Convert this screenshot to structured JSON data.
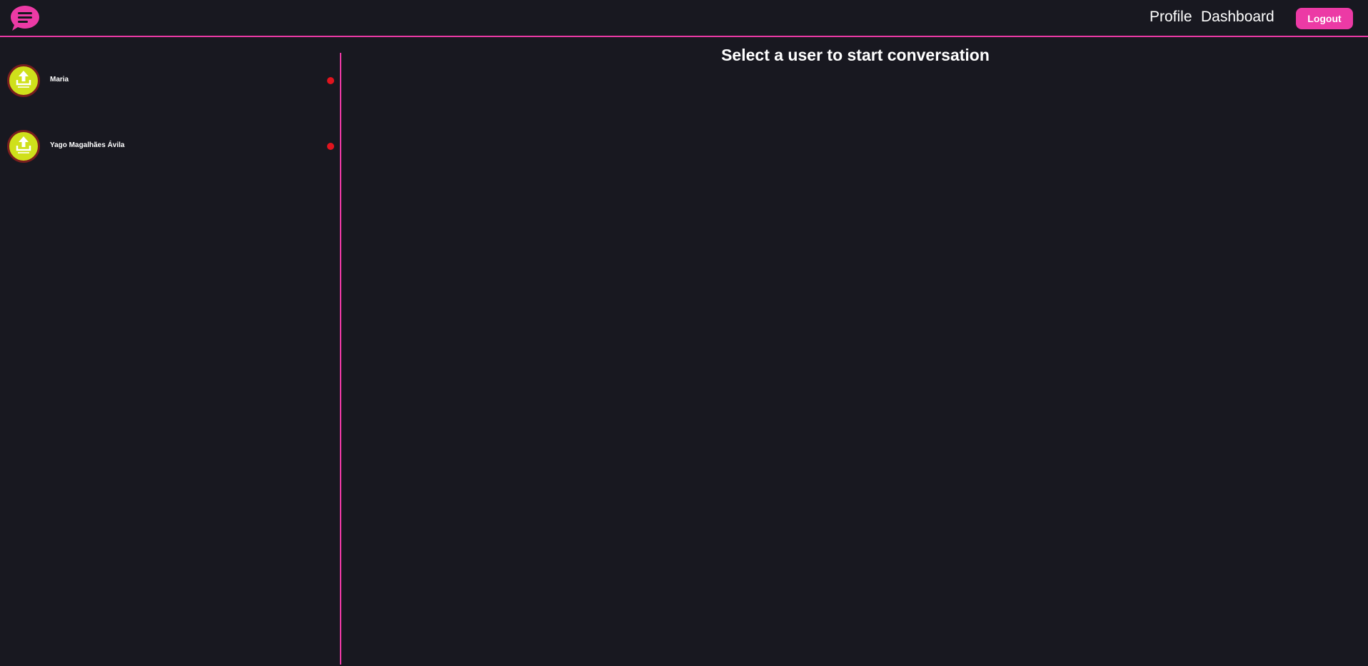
{
  "header": {
    "logo_icon": "chat-bubble-menu-icon",
    "nav": {
      "profile_label": "Profile",
      "dashboard_label": "Dashboard"
    },
    "logout_label": "Logout"
  },
  "sidebar": {
    "users": [
      {
        "name": "Maria",
        "avatar_icon": "upload-icon",
        "status": "offline"
      },
      {
        "name": "Yago Magalhães Ávila",
        "avatar_icon": "upload-icon",
        "status": "offline"
      }
    ]
  },
  "main": {
    "title": "Select a user to start conversation"
  },
  "colors": {
    "background": "#181820",
    "accent": "#ec3aa5",
    "avatar_fill": "#cfe01b",
    "status_offline": "#e0141e"
  }
}
